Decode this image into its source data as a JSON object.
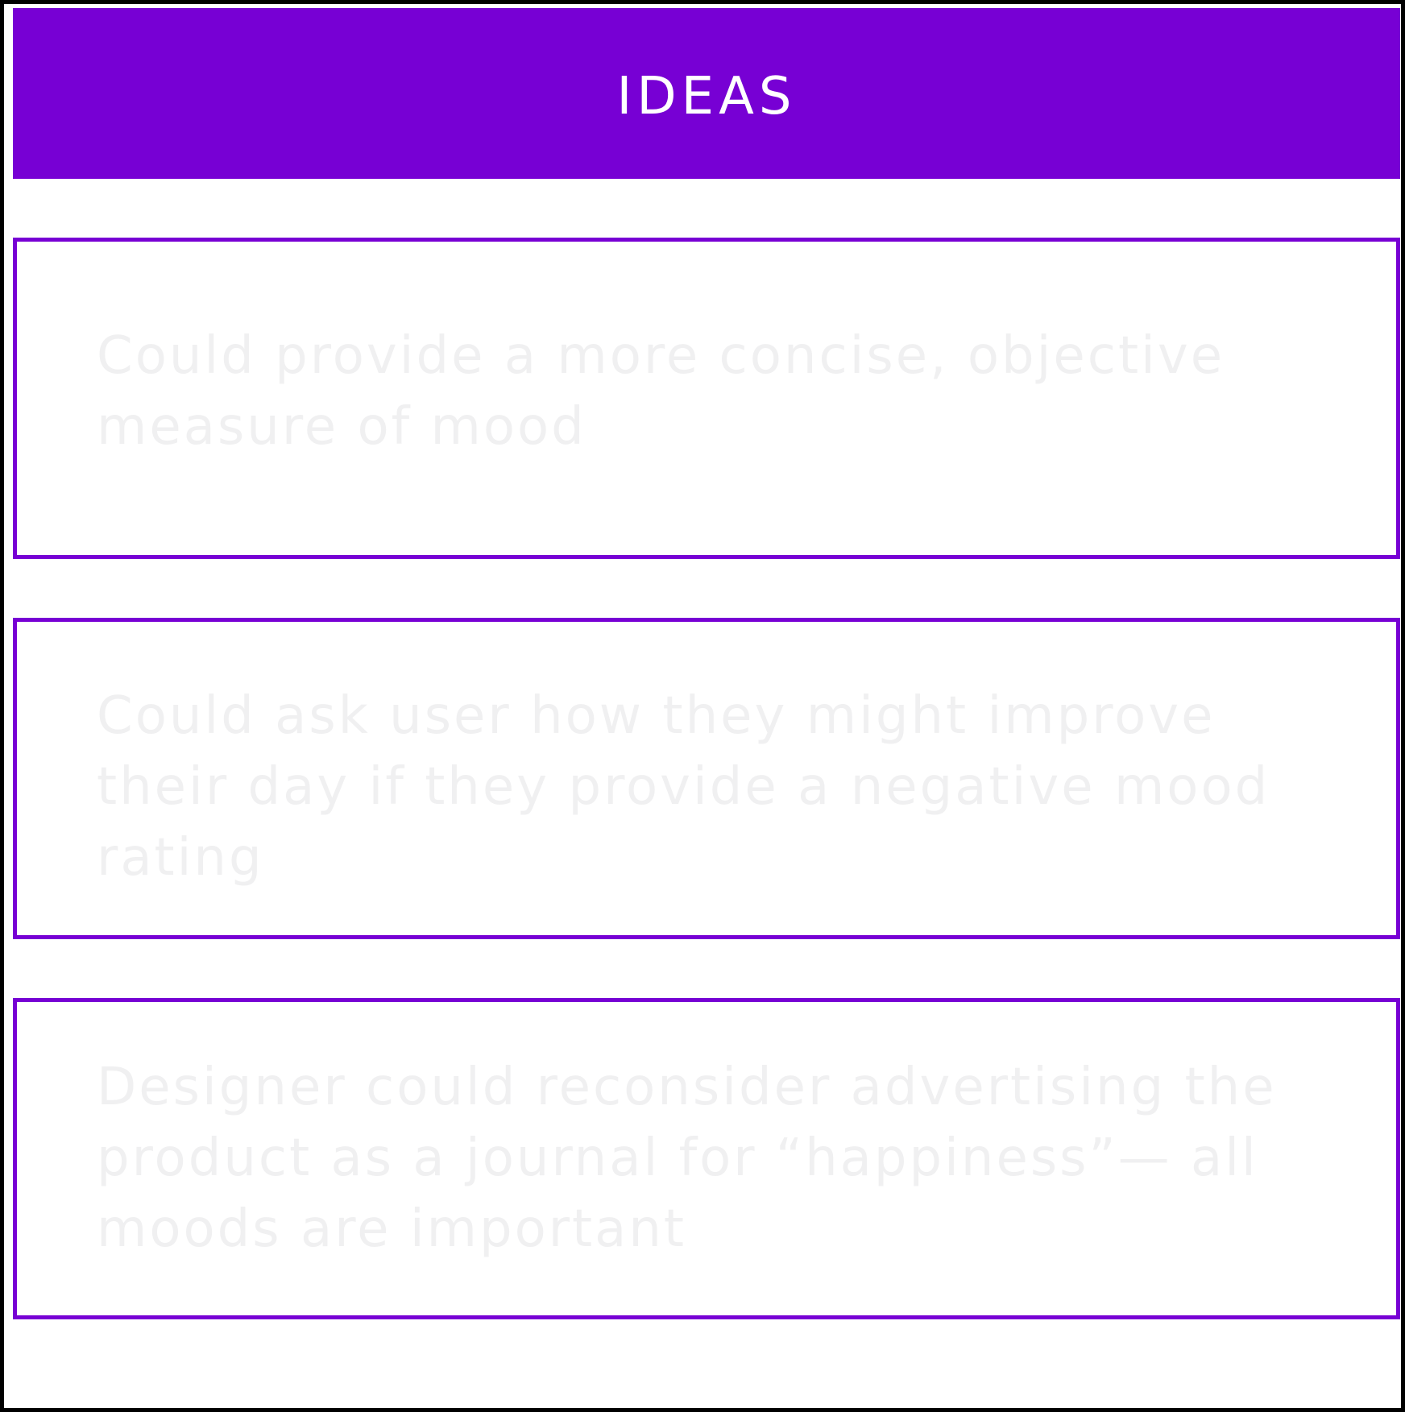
{
  "header": {
    "title": "IDEAS",
    "background_color": "#7700d4"
  },
  "ideas": [
    {
      "text": "Could provide a more concise, objective\nmeasure of mood"
    },
    {
      "text": "Could ask user how they might improve\ntheir day if they provide a negative mood\nrating"
    },
    {
      "text": "Designer could reconsider advertising the\nproduct as a journal for “happiness”— all\nmoods are important"
    }
  ],
  "colors": {
    "accent": "#7700d4",
    "card_text": "#f0f0f1",
    "frame_border": "#000000"
  }
}
